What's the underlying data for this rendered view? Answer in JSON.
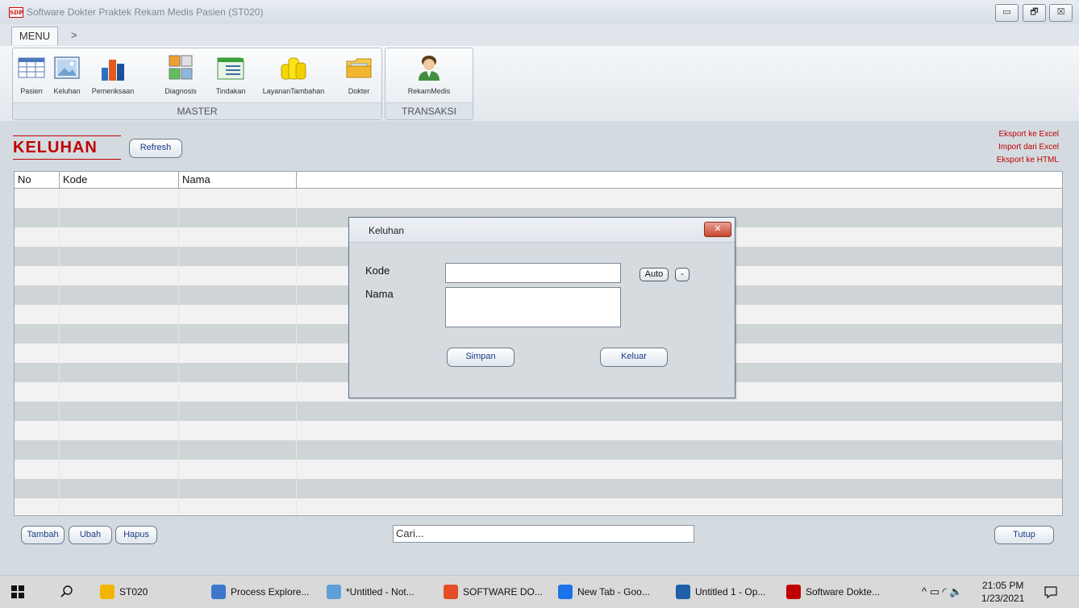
{
  "window": {
    "title": "Software Dokter Praktek Rekam Medis Pasien (ST020)",
    "icon_text": "SDP",
    "minimize": "▭",
    "restore": "🗗",
    "close": "☒"
  },
  "menu": {
    "tab": "MENU",
    "more": ">"
  },
  "ribbon": {
    "master": {
      "label": "MASTER",
      "items": [
        {
          "label": "Pasien",
          "icon": "table-icon"
        },
        {
          "label": "Keluhan",
          "icon": "picture-icon"
        },
        {
          "label": "Pemeriksaan",
          "icon": "bar-chart-icon"
        },
        {
          "label": "Diagnosis",
          "icon": "images-grid-icon"
        },
        {
          "label": "Tindakan",
          "icon": "list-icon"
        },
        {
          "label": "LayananTambahan",
          "icon": "coins-icon"
        },
        {
          "label": "Dokter",
          "icon": "folder-icon"
        }
      ]
    },
    "transaksi": {
      "label": "TRANSAKSI",
      "items": [
        {
          "label": "RekamMedis",
          "icon": "user-icon"
        }
      ]
    }
  },
  "page": {
    "title": "KELUHAN",
    "refresh": "Refresh",
    "links": [
      "Eksport ke Excel",
      "Import dari Excel",
      "Eksport ke HTML"
    ]
  },
  "grid": {
    "columns": [
      "No",
      "Kode",
      "Nama"
    ],
    "rows": [
      {
        "no": "",
        "kode": "",
        "nama": ""
      },
      {
        "no": "",
        "kode": "",
        "nama": ""
      },
      {
        "no": "",
        "kode": "",
        "nama": ""
      },
      {
        "no": "",
        "kode": "",
        "nama": ""
      },
      {
        "no": "",
        "kode": "",
        "nama": ""
      },
      {
        "no": "",
        "kode": "",
        "nama": ""
      },
      {
        "no": "",
        "kode": "",
        "nama": ""
      },
      {
        "no": "",
        "kode": "",
        "nama": ""
      },
      {
        "no": "",
        "kode": "",
        "nama": ""
      },
      {
        "no": "",
        "kode": "",
        "nama": ""
      },
      {
        "no": "",
        "kode": "",
        "nama": ""
      },
      {
        "no": "",
        "kode": "",
        "nama": ""
      },
      {
        "no": "",
        "kode": "",
        "nama": ""
      },
      {
        "no": "",
        "kode": "",
        "nama": ""
      },
      {
        "no": "",
        "kode": "",
        "nama": ""
      },
      {
        "no": "",
        "kode": "",
        "nama": ""
      },
      {
        "no": "",
        "kode": "",
        "nama": ""
      }
    ]
  },
  "bottom": {
    "tambah": "Tambah",
    "ubah": "Ubah",
    "hapus": "Hapus",
    "search_value": "Cari...",
    "tutup": "Tutup"
  },
  "dialog": {
    "title": "Keluhan",
    "close": "✕",
    "kode_label": "Kode",
    "nama_label": "Nama",
    "kode_value": "",
    "nama_value": "",
    "auto": "Auto",
    "minus": "-",
    "simpan": "Simpan",
    "keluar": "Keluar"
  },
  "taskbar": {
    "items": [
      {
        "label": "ST020",
        "color": "#f2b600"
      },
      {
        "label": "Process Explore...",
        "color": "#3d77c9"
      },
      {
        "label": "*Untitled - Not...",
        "color": "#5fa0d8"
      },
      {
        "label": "SOFTWARE DO...",
        "color": "#e44d26"
      },
      {
        "label": "New Tab - Goo...",
        "color": "#1a73e8"
      },
      {
        "label": "Untitled 1 - Op...",
        "color": "#1f5fa8"
      },
      {
        "label": "Software Dokte...",
        "color": "#c00000"
      }
    ],
    "time": "21:05 PM",
    "date": "1/23/2021"
  },
  "colors": {
    "accent_red": "#c00000",
    "link_blue": "#1a3b8a"
  }
}
